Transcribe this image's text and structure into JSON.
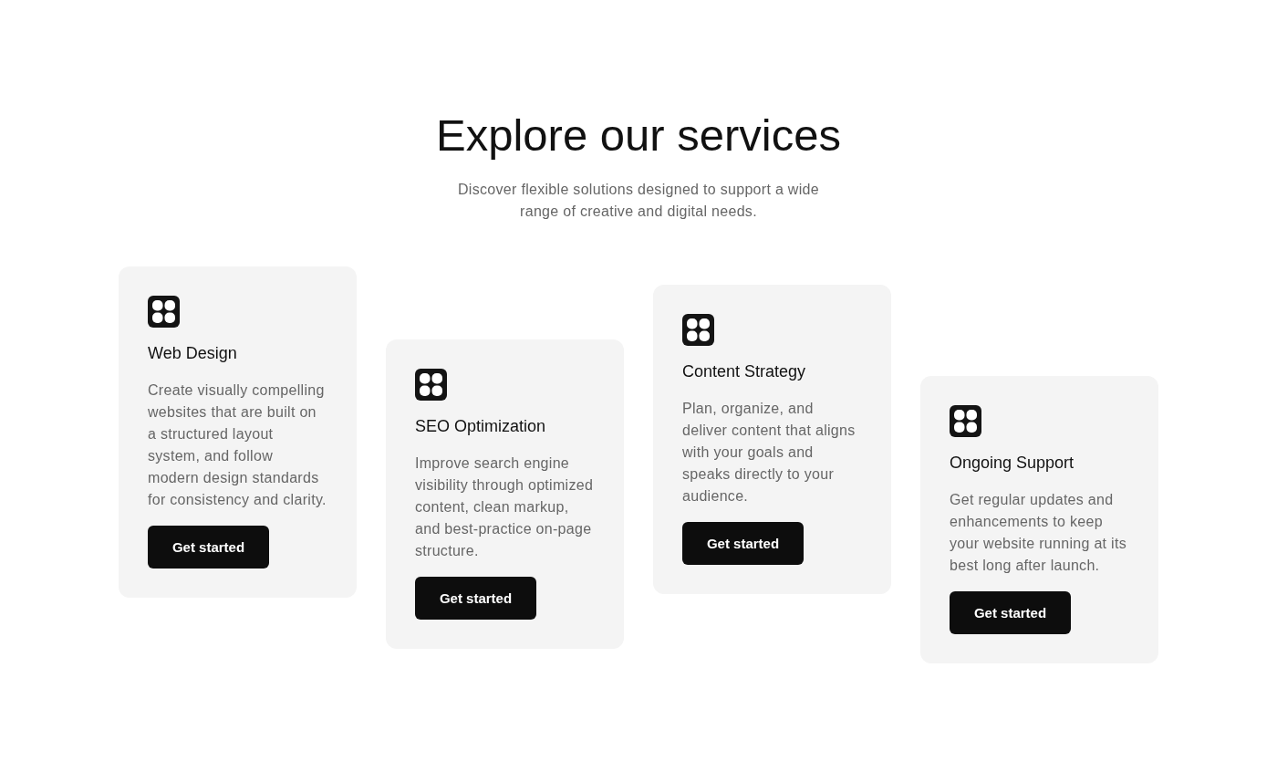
{
  "section": {
    "title": "Explore our services",
    "subtitle": "Discover flexible solutions designed to support a wide range of creative and digital needs."
  },
  "cards": [
    {
      "title": "Web Design",
      "description": "Create visually compelling websites that are built on a structured layout system, and follow modern design standards for consistency and clarity.",
      "button": "Get started"
    },
    {
      "title": "SEO Optimization",
      "description": "Improve search engine visibility through optimized content, clean markup, and best-practice on-page structure.",
      "button": "Get started"
    },
    {
      "title": "Content Strategy",
      "description": "Plan, organize, and deliver content that aligns with your goals and speaks directly to your audience.",
      "button": "Get started"
    },
    {
      "title": "Ongoing Support",
      "description": "Get regular updates and enhancements to keep your website running at its best long after launch.",
      "button": "Get started"
    }
  ]
}
